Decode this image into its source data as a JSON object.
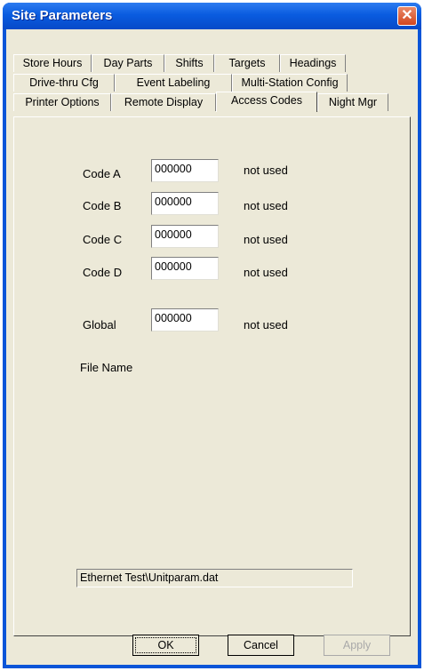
{
  "window": {
    "title": "Site Parameters",
    "close_glyph": "✕"
  },
  "tabs": {
    "row1": [
      "Store Hours",
      "Day Parts",
      "Shifts",
      "Targets",
      "Headings"
    ],
    "row2": [
      "Drive-thru Cfg",
      "Event Labeling",
      "Multi-Station Config"
    ],
    "row3": [
      "Printer Options",
      "Remote Display",
      "Access Codes",
      "Night Mgr"
    ],
    "active": "Access Codes"
  },
  "codes": [
    {
      "label": "Code A",
      "value": "000000",
      "status": "not used"
    },
    {
      "label": "Code B",
      "value": "000000",
      "status": "not used"
    },
    {
      "label": "Code C",
      "value": "000000",
      "status": "not used"
    },
    {
      "label": "Code D",
      "value": "000000",
      "status": "not used"
    },
    {
      "label": "Global",
      "value": "000000",
      "status": "not used"
    }
  ],
  "file": {
    "label": "File Name",
    "value": "Ethernet Test\\Unitparam.dat"
  },
  "buttons": {
    "ok": "OK",
    "cancel": "Cancel",
    "apply": "Apply"
  }
}
